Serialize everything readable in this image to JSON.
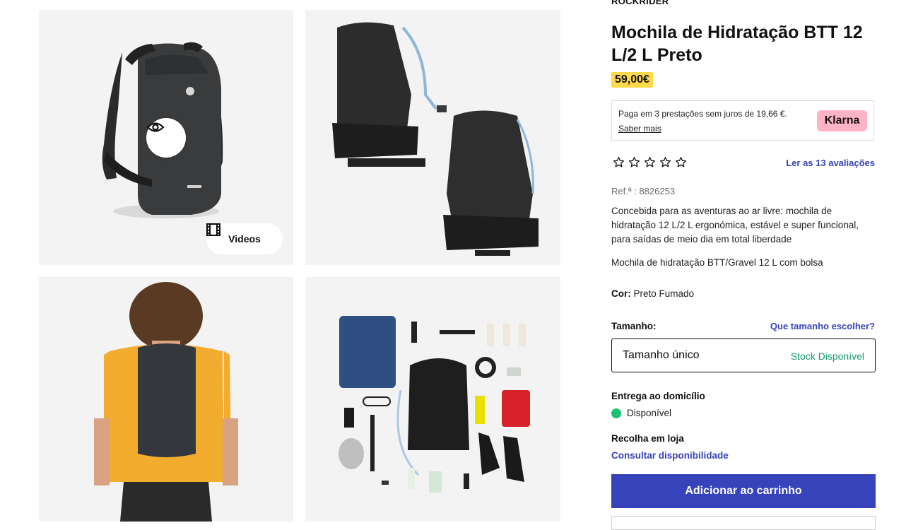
{
  "gallery": {
    "videos_label": "Videos"
  },
  "product": {
    "brand": "ROCKRIDER",
    "title": "Mochila de Hidratação BTT 12 L/2 L Preto",
    "price": "59,00€",
    "klarna": {
      "text": "Paga em 3 prestações sem juros de 19,66 €.",
      "link": "Saber mais",
      "badge": "Klarna"
    },
    "rating_stars": 5,
    "reviews_link": "Ler as 13 avaliações",
    "ref": "Ref.ª : 8826253",
    "description": "Concebida para as aventuras ao ar livre: mochila de hidratação 12 L/2 L ergonómica, estável e super funcional, para saídas de meio dia em total liberdade",
    "subtitle": "Mochila de hidratação BTT/Gravel 12 L com bolsa",
    "color_label": "Cor:",
    "color_value": "Preto Fumado",
    "size_label": "Tamanho:",
    "size_guide_link": "Que tamanho escolher?",
    "size_value": "Tamanho único",
    "size_stock": "Stock Disponível",
    "delivery_label": "Entrega ao domicílio",
    "delivery_status": "Disponível",
    "store_label": "Recolha em loja",
    "store_link": "Consultar disponibilidade",
    "add_to_cart": "Adicionar ao carrinho"
  },
  "colors": {
    "accent": "#3643ba",
    "price_bg": "#ffd94a",
    "klarna_bg": "#ffb3c7",
    "available": "#1dbf73",
    "stock_text": "#149b6b"
  }
}
